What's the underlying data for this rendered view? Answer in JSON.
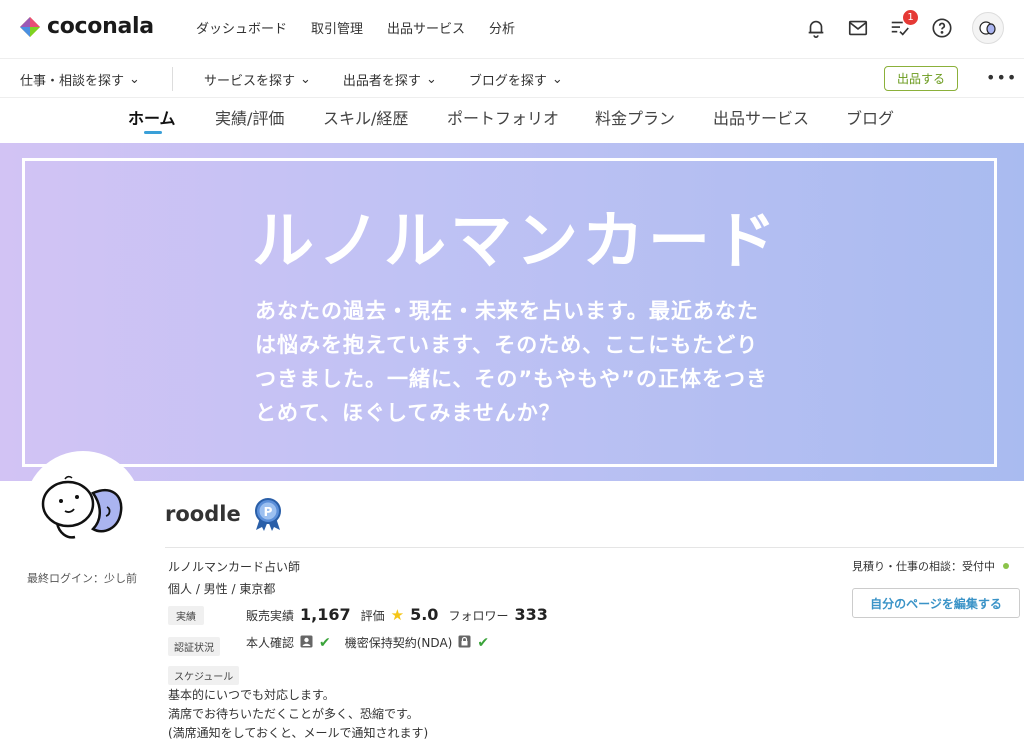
{
  "brand": {
    "name": "coconala"
  },
  "header": {
    "nav": [
      "ダッシュボード",
      "取引管理",
      "出品サービス",
      "分析"
    ],
    "notification_badge": "1"
  },
  "subnav": {
    "find_work": "仕事・相談を探す",
    "items": [
      "サービスを探す",
      "出品者を探す",
      "ブログを探す"
    ],
    "sell_button": "出品する",
    "more": "•••"
  },
  "tabs": [
    "ホーム",
    "実績/評価",
    "スキル/経歴",
    "ポートフォリオ",
    "料金プラン",
    "出品サービス",
    "ブログ"
  ],
  "banner": {
    "title": "ルノルマンカード",
    "text": "あなたの過去・現在・未来を占います。最近あなたは悩みを抱えています、そのため、ここにもたどりつきました。一緒に、その”もやもや”の正体をつきとめて、ほぐしてみませんか？"
  },
  "profile": {
    "name": "roodle",
    "last_login": "最終ログイン：少し前",
    "role": "ルノルマンカード占い師",
    "personal": "個人 / 男性 / 東京都",
    "stats_tag": "実績",
    "sales_label": "販売実績",
    "sales_value": "1,167",
    "rating_label": "評価",
    "rating_value": "5.0",
    "followers_label": "フォロワー",
    "followers_value": "333",
    "verify_tag": "認証状況",
    "identity_label": "本人確認",
    "nda_label": "機密保持契約(NDA)",
    "schedule_tag": "スケジュール",
    "schedule_lines": [
      "基本的にいつでも対応します。",
      "満席でお待ちいただくことが多く、恐縮です。",
      "(満席通知をしておくと、メールで通知されます)"
    ],
    "consult_status": "見積り・仕事の相談：受付中",
    "edit_button": "自分のページを編集する"
  },
  "colors": {
    "accent_blue": "#3aa0d8",
    "sell_green": "#6a9a1c",
    "status_green": "#8bc34a",
    "check_green": "#3aa33a",
    "badge_red": "#e53935"
  }
}
